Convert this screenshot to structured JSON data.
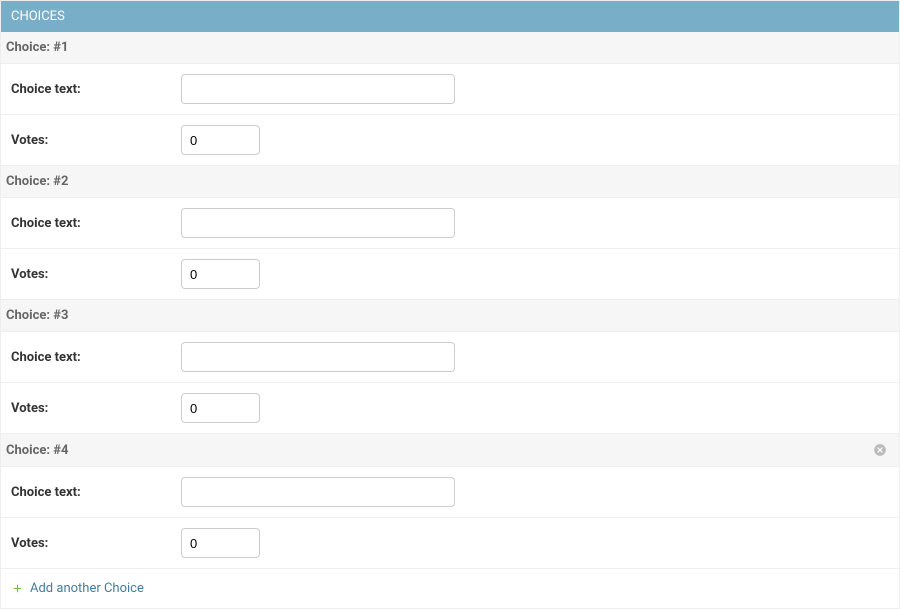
{
  "panel_title": "CHOICES",
  "labels": {
    "choice_text": "Choice text:",
    "votes": "Votes:"
  },
  "choices": [
    {
      "header": "Choice: #1",
      "text": "",
      "votes": "0",
      "deletable": false
    },
    {
      "header": "Choice: #2",
      "text": "",
      "votes": "0",
      "deletable": false
    },
    {
      "header": "Choice: #3",
      "text": "",
      "votes": "0",
      "deletable": false
    },
    {
      "header": "Choice: #4",
      "text": "",
      "votes": "0",
      "deletable": true
    }
  ],
  "add_link": "Add another Choice"
}
